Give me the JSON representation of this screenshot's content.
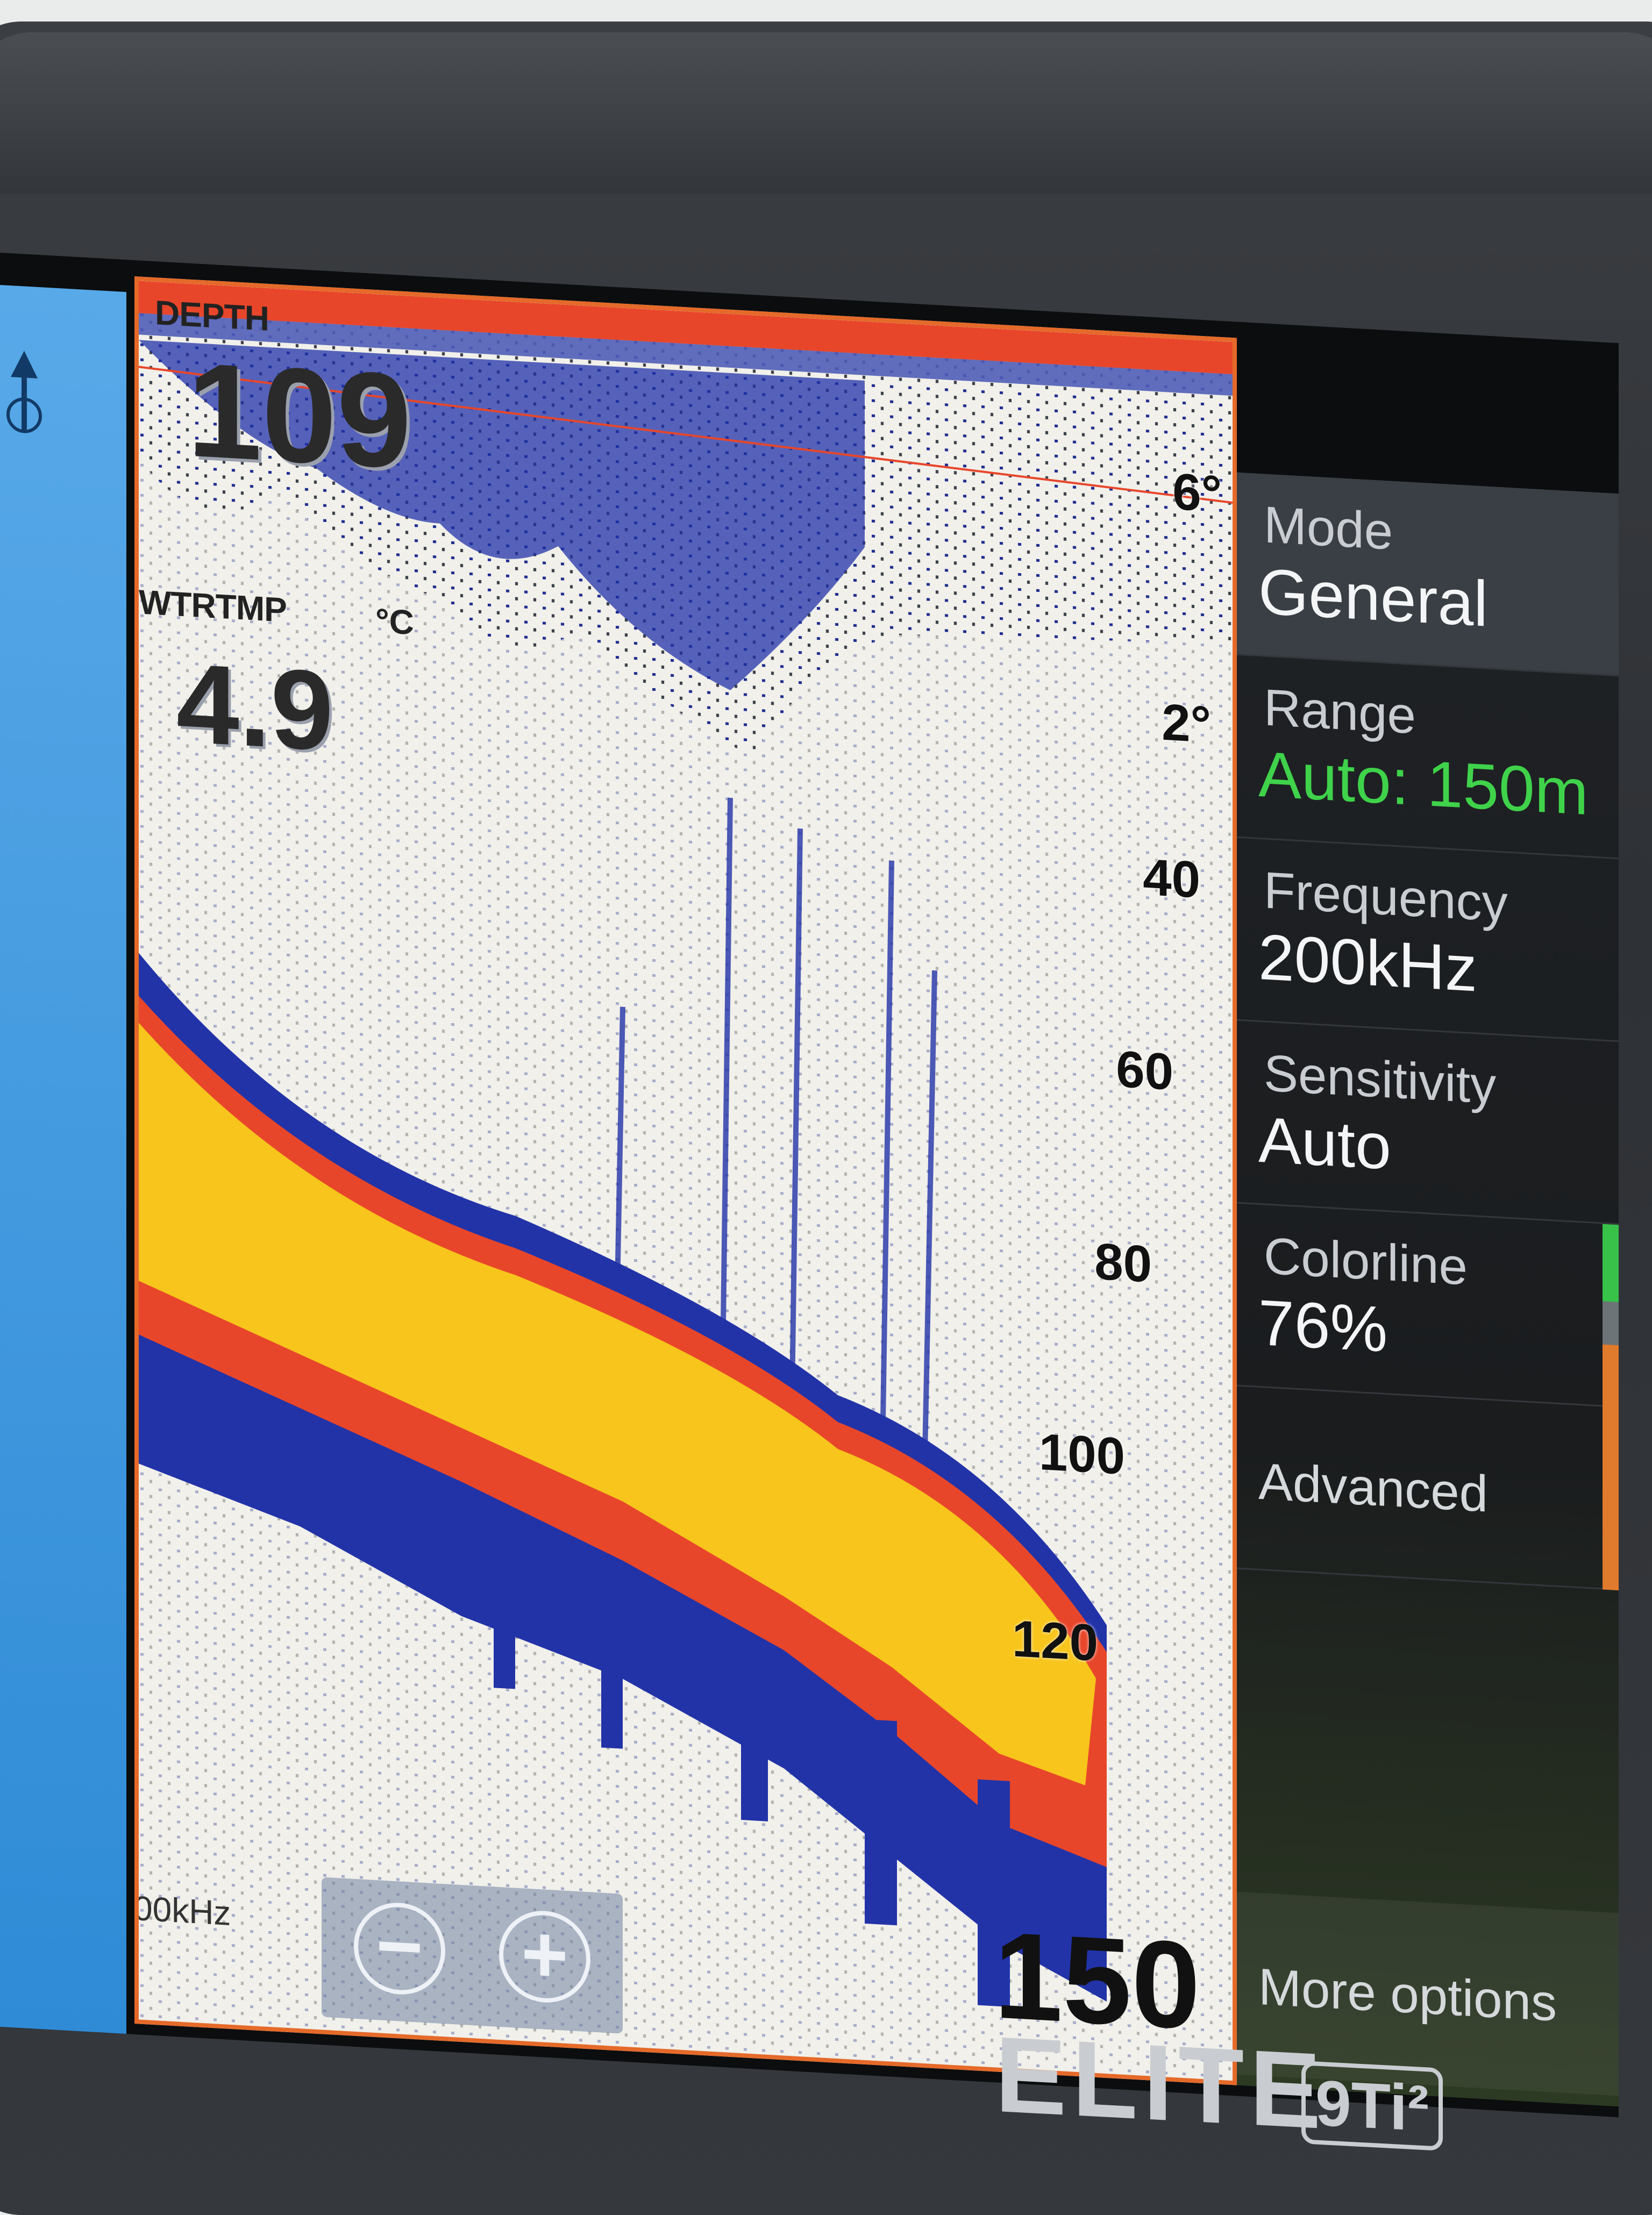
{
  "sonar": {
    "depth_label": "DEPTH",
    "depth_value": "109",
    "temp_label": "WTRTMP",
    "temp_unit": "°C",
    "temp_value": "4.9",
    "frequency_label": "00kHz",
    "range_max": "150",
    "scale": [
      "6°",
      "2°",
      "40",
      "60",
      "80",
      "100",
      "120"
    ]
  },
  "zoom": {
    "minus": "−",
    "plus": "+"
  },
  "menu": {
    "mode": {
      "label": "Mode",
      "value": "General"
    },
    "range": {
      "label": "Range",
      "value": "Auto: 150m"
    },
    "frequency": {
      "label": "Frequency",
      "value": "200kHz"
    },
    "sensitivity": {
      "label": "Sensitivity",
      "value": "Auto"
    },
    "colorline": {
      "label": "Colorline",
      "value": "76%"
    },
    "advanced": {
      "label": "Advanced"
    },
    "more": {
      "label": "More options"
    }
  },
  "colorline_level": 0.76,
  "device": {
    "brand": "ELITE",
    "model": "9Ti²"
  },
  "colors": {
    "frame": "#e56a2a",
    "range_value": "#3fd24a",
    "bottom_strong": "#f7c51b",
    "bottom_mid": "#e8462a",
    "bottom_weak": "#2233a8"
  }
}
